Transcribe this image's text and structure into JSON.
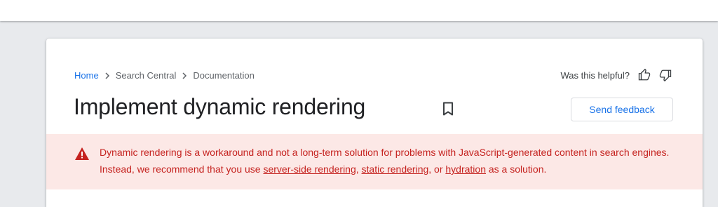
{
  "breadcrumb": {
    "home": "Home",
    "level2": "Search Central",
    "level3": "Documentation"
  },
  "helpful": {
    "question": "Was this helpful?",
    "up_icon": "thumb-up-icon",
    "down_icon": "thumb-down-icon"
  },
  "page": {
    "title": "Implement dynamic rendering",
    "bookmark_icon": "bookmark-icon"
  },
  "feedback_button": {
    "label": "Send feedback"
  },
  "warning": {
    "icon": "warning-icon",
    "line1": "Dynamic rendering is a workaround and not a long-term solution for problems with JavaScript-generated content in search engines.",
    "line2_prefix": "Instead, we recommend that you use ",
    "link1": "server-side rendering",
    "sep1": ", ",
    "link2": "static rendering",
    "sep2": ", or ",
    "link3": "hydration",
    "suffix": " as a solution."
  },
  "colors": {
    "accent": "#1a73e8",
    "warning_bg": "#fce8e6",
    "warning_text": "#c5221f",
    "page_bg": "#e8eaed"
  }
}
